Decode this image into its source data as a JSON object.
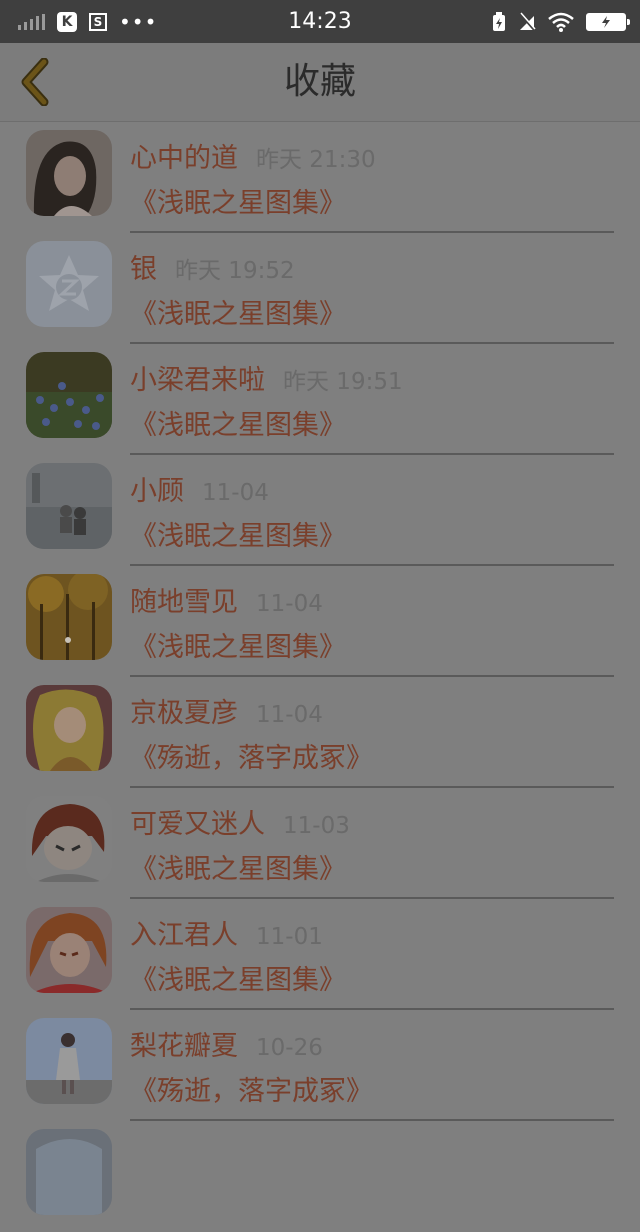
{
  "status_bar": {
    "time": "14:23",
    "left_icons": [
      "signal-bars-icon",
      "k-app-icon",
      "s-app-icon",
      "more-dots-icon"
    ],
    "right_icons": [
      "charging-icon",
      "no-sim-icon",
      "wifi-icon",
      "battery-icon"
    ],
    "k_label": "K",
    "s_label": "S",
    "dots": "•••"
  },
  "header": {
    "title": "收藏",
    "back_icon": "chevron-left-icon"
  },
  "colors": {
    "status_bg": "#3f3f3f",
    "page_bg": "#7f7f7f",
    "accent_text": "#7a3f2b",
    "muted_text": "#6a6a6a",
    "back_icon": "#6b5418"
  },
  "items": [
    {
      "name": "心中的道",
      "time": "昨天 21:30",
      "collection": "《浅眠之星图集》",
      "avatar": "portrait-girl"
    },
    {
      "name": "银",
      "time": "昨天 19:52",
      "collection": "《浅眠之星图集》",
      "avatar": "qq-default-avatar"
    },
    {
      "name": "小梁君来啦",
      "time": "昨天 19:51",
      "collection": "《浅眠之星图集》",
      "avatar": "blue-flowers"
    },
    {
      "name": "小顾",
      "time": "11-04",
      "collection": "《浅眠之星图集》",
      "avatar": "couple-lake"
    },
    {
      "name": "随地雪见",
      "time": "11-04",
      "collection": "《浅眠之星图集》",
      "avatar": "autumn-forest"
    },
    {
      "name": "京极夏彦",
      "time": "11-04",
      "collection": "《殇逝，落字成冢》",
      "avatar": "anime-blonde-girl"
    },
    {
      "name": "可爱又迷人",
      "time": "11-03",
      "collection": "《浅眠之星图集》",
      "avatar": "anime-red-hair"
    },
    {
      "name": "入江君人",
      "time": "11-01",
      "collection": "《浅眠之星图集》",
      "avatar": "anime-boy"
    },
    {
      "name": "梨花瓣夏",
      "time": "10-26",
      "collection": "《殇逝，落字成冢》",
      "avatar": "girl-sky"
    }
  ]
}
